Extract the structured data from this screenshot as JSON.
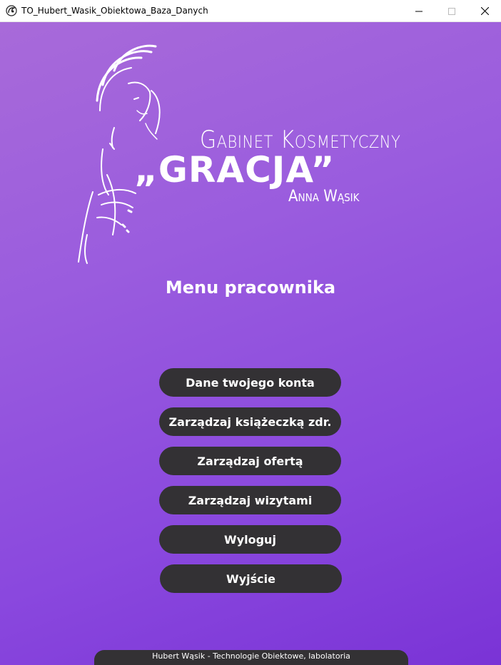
{
  "window": {
    "title": "TO_Hubert_Wasik_Obiektowa_Baza_Danych",
    "app_icon": "salon-logo-icon",
    "controls": [
      "minimize-icon",
      "maximize-icon",
      "close-icon"
    ]
  },
  "brand": {
    "line1": "Gabinet Kosmetyczny",
    "line2": "„GRACJA”",
    "line3": "Anna Wąsik",
    "logo_icon": "woman-silhouette-icon"
  },
  "menu": {
    "heading": "Menu pracownika",
    "buttons": [
      "Dane twojego konta",
      "Zarządzaj książeczką zdr.",
      "Zarządzaj ofertą",
      "Zarządzaj wizytami",
      "Wyloguj",
      "Wyjście"
    ]
  },
  "footer": {
    "text": "Hubert Wąsik - Technologie Obiektowe, labolatoria"
  },
  "colors": {
    "gradient_start": "#a86ad9",
    "gradient_end": "#7a33d6",
    "button_bg": "#333134",
    "text": "#ffffff"
  }
}
